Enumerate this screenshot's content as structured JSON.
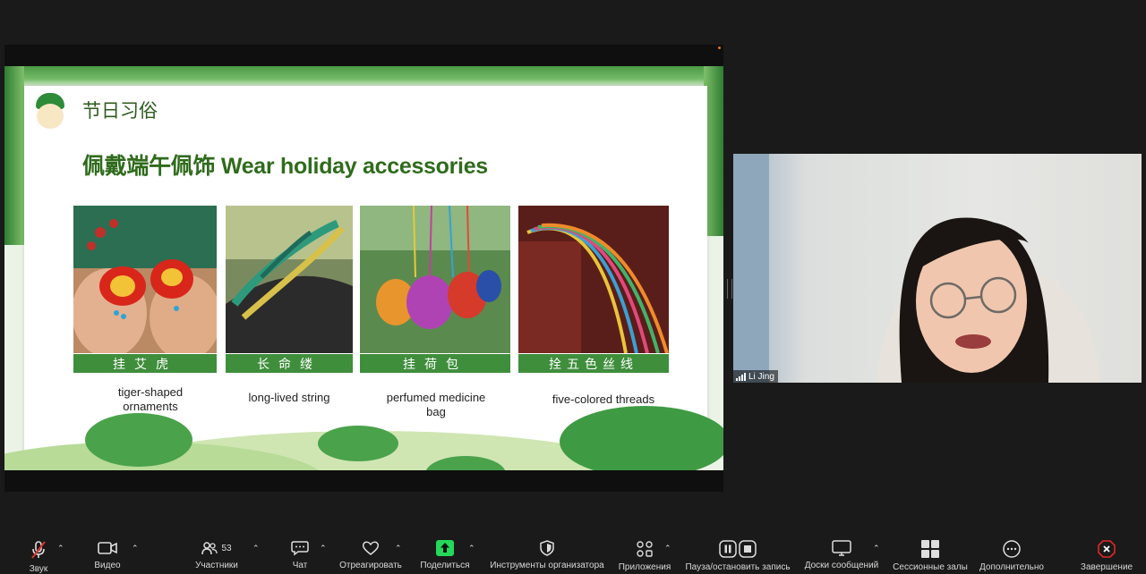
{
  "slide": {
    "section_title": "节日习俗",
    "heading": "佩戴端午佩饰 Wear holiday accessories",
    "items": [
      {
        "cn_label": "挂艾虎",
        "en_label": "tiger-shaped\nornaments"
      },
      {
        "cn_label": "长命缕",
        "en_label": "long-lived string"
      },
      {
        "cn_label": "挂荷包",
        "en_label": "perfumed medicine\nbag"
      },
      {
        "cn_label": "拴五色丝线",
        "en_label": "five-colored threads"
      }
    ]
  },
  "participant": {
    "name": "Li Jing"
  },
  "toolbar": {
    "items": [
      {
        "label": "Звук",
        "icon": "mic-muted-icon"
      },
      {
        "label": "Видео",
        "icon": "video-camera-icon"
      },
      {
        "label": "Участники",
        "icon": "participants-icon",
        "count": "53"
      },
      {
        "label": "Чат",
        "icon": "chat-icon"
      },
      {
        "label": "Отреагировать",
        "icon": "heart-icon"
      },
      {
        "label": "Поделиться",
        "icon": "share-screen-icon"
      },
      {
        "label": "Инструменты организатора",
        "icon": "shield-icon"
      },
      {
        "label": "Приложения",
        "icon": "apps-icon"
      },
      {
        "label": "Пауза/остановить запись",
        "icon": "record-controls-icon"
      },
      {
        "label": "Доски сообщений",
        "icon": "whiteboard-icon"
      },
      {
        "label": "Сессионные залы",
        "icon": "breakout-rooms-icon"
      },
      {
        "label": "Дополнительно",
        "icon": "more-icon"
      },
      {
        "label": "Завершение",
        "icon": "end-meeting-icon"
      }
    ]
  },
  "colors": {
    "share_accent": "#23d959",
    "end_red": "#e02828",
    "slide_green": "#3f8e3c"
  }
}
